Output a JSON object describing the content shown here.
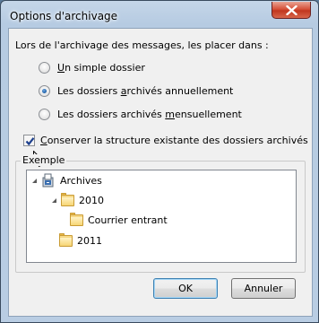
{
  "window": {
    "title": "Options d'archivage"
  },
  "dialog": {
    "prompt": "Lors de l'archivage des messages, les placer dans :",
    "radios": [
      {
        "pre": "",
        "u": "U",
        "post": "n simple dossier",
        "checked": false
      },
      {
        "pre": "Les dossiers ",
        "u": "a",
        "post": "rchivés annuellement",
        "checked": true
      },
      {
        "pre": "Les dossiers archivés ",
        "u": "m",
        "post": "ensuellement",
        "checked": false
      }
    ],
    "checkbox": {
      "u": "C",
      "post": "onserver la structure existante des dossiers archivés",
      "checked": true
    },
    "example": {
      "label": "Exemple",
      "tree": [
        {
          "label": "Archives",
          "icon": "archive-icon",
          "expanded": true
        },
        {
          "label": "2010",
          "icon": "folder-icon",
          "expanded": true
        },
        {
          "label": "Courrier entrant",
          "icon": "folder-icon"
        },
        {
          "label": "2011",
          "icon": "folder-icon"
        }
      ]
    },
    "buttons": {
      "ok": "OK",
      "cancel": "Annuler"
    }
  }
}
